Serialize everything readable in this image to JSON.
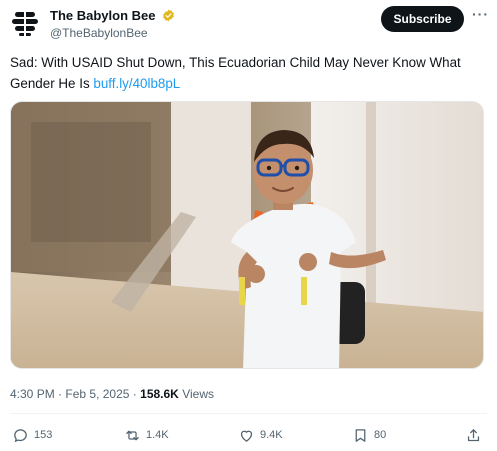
{
  "account": {
    "name": "The Babylon Bee",
    "handle": "@TheBabylonBee",
    "subscribe_label": "Subscribe",
    "more_label": "···"
  },
  "tweet": {
    "text": "Sad: With USAID Shut Down, This Ecuadorian Child May Never Know What Gender He Is",
    "link": "buff.ly/40lb8pL",
    "time": "4:30 PM",
    "date": "Feb 5, 2025",
    "views_count": "158.6K",
    "views_label": "Views"
  },
  "actions": {
    "replies": "153",
    "reposts": "1.4K",
    "likes": "9.4K",
    "bookmarks": "80"
  },
  "colors": {
    "link": "#1d9bf0",
    "secondary": "#536471",
    "verified": "#e2b719"
  }
}
